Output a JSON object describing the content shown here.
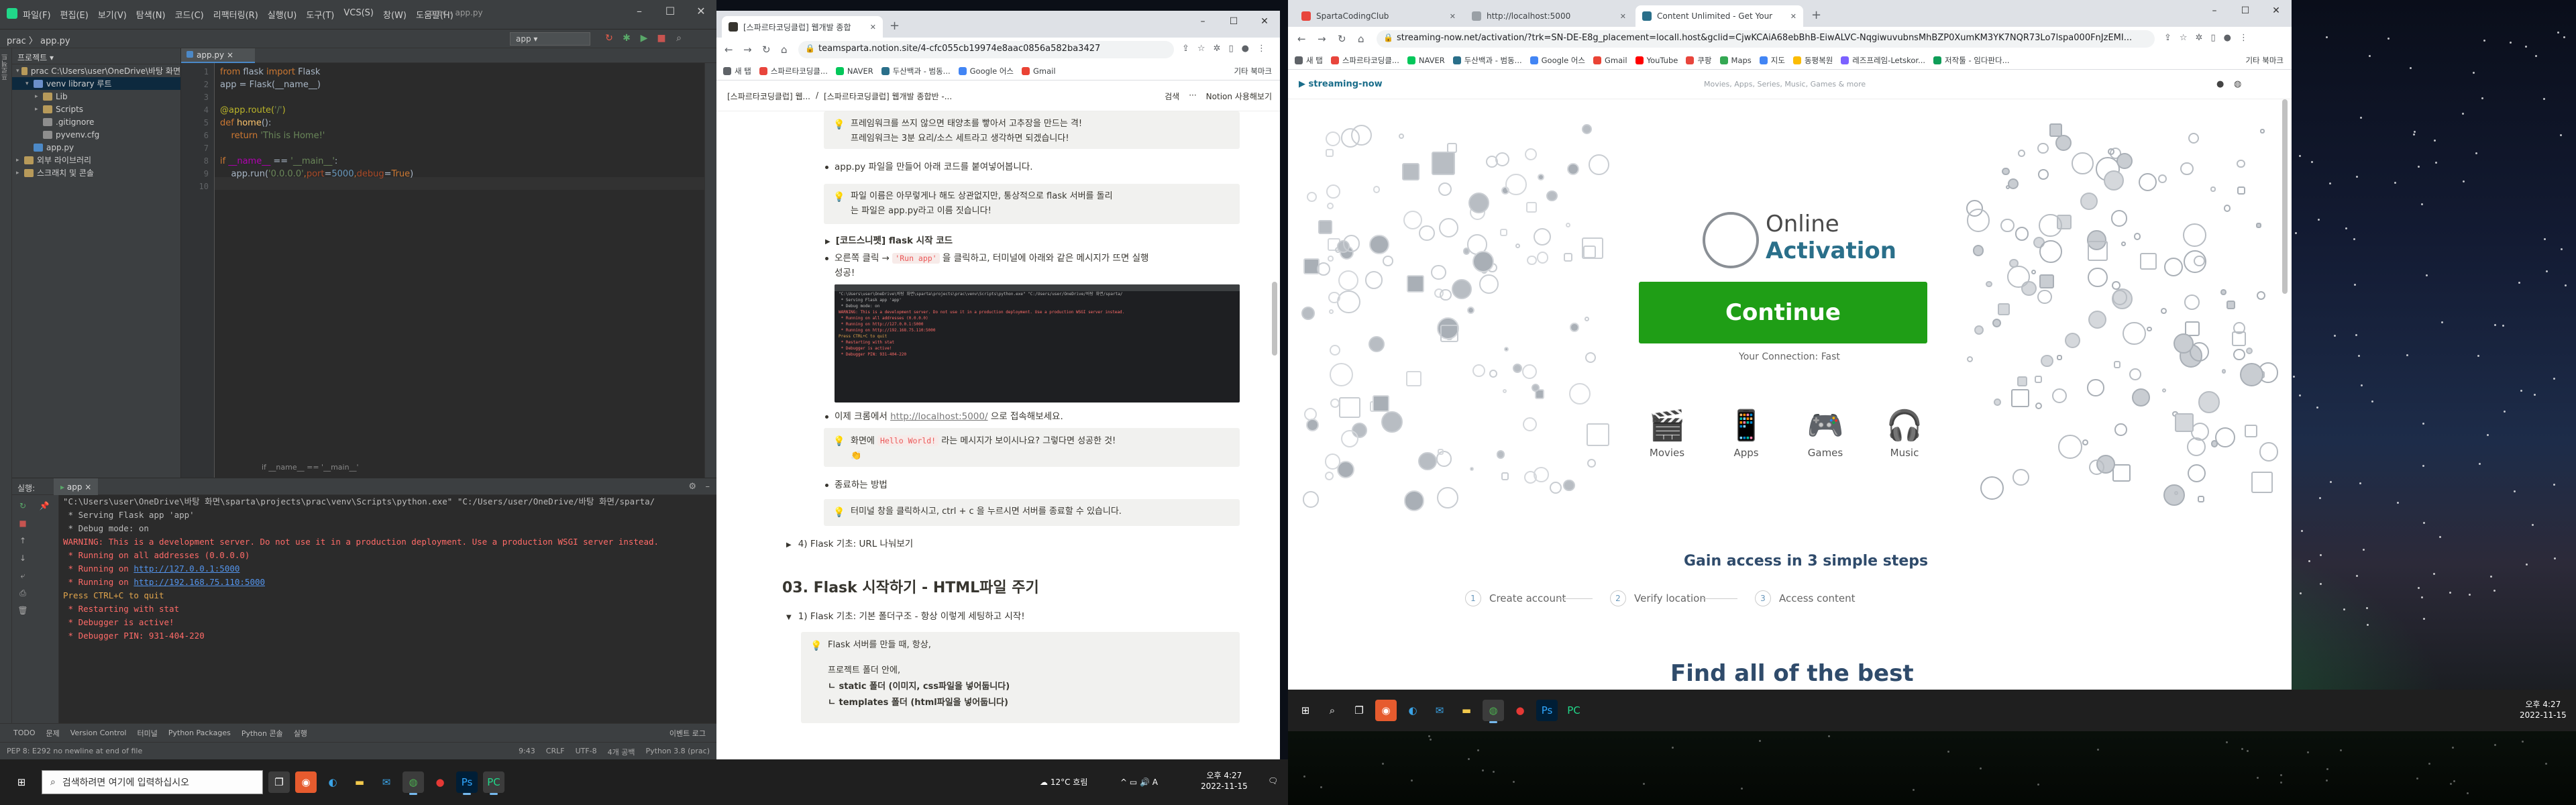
{
  "ide": {
    "menu": [
      "파일(F)",
      "편집(E)",
      "보기(V)",
      "탐색(N)",
      "코드(C)",
      "리팩터링(R)",
      "실행(U)",
      "도구(T)",
      "VCS(S)",
      "창(W)",
      "도움말(H)"
    ],
    "title": "prac - app.py",
    "breadcrumb": "prac 〉 app.py",
    "run_config": "app",
    "project_panel_title": "프로젝트",
    "tree": [
      {
        "label": "prac C:\\Users\\user\\OneDrive\\바탕 화면",
        "kind": "folder",
        "depth": 0,
        "open": true
      },
      {
        "label": "venv library 루트",
        "kind": "folder-blue",
        "depth": 1,
        "open": true,
        "selected": true
      },
      {
        "label": "Lib",
        "kind": "folder",
        "depth": 2,
        "open": false
      },
      {
        "label": "Scripts",
        "kind": "folder",
        "depth": 2,
        "open": false
      },
      {
        "label": ".gitignore",
        "kind": "cfg",
        "depth": 2
      },
      {
        "label": "pyvenv.cfg",
        "kind": "cfg",
        "depth": 2
      },
      {
        "label": "app.py",
        "kind": "py",
        "depth": 1
      },
      {
        "label": "외부 라이브러리",
        "kind": "folder",
        "depth": 0,
        "open": false
      },
      {
        "label": "스크래치 및 콘솔",
        "kind": "folder",
        "depth": 0,
        "open": false
      }
    ],
    "editor_tab": "app.py",
    "line_numbers": [
      "1",
      "2",
      "3",
      "4",
      "5",
      "6",
      "7",
      "8",
      "9",
      "10"
    ],
    "code": {
      "l1_a": "from",
      "l1_b": " flask ",
      "l1_c": "import",
      "l1_d": " Flask",
      "l2": "app = Flask(__name__)",
      "l4_a": "@app.route(",
      "l4_b": "'/'",
      "l4_c": ")",
      "l5_a": "def",
      "l5_b": " home",
      "l5_c": "():",
      "l6_a": "    return",
      "l6_b": " 'This is Home!'",
      "l8_a": "if",
      "l8_b": " __name__",
      "l8_c": " == ",
      "l8_d": "'__main__'",
      "l8_e": ":",
      "l9_a": "    app.run(",
      "l9_b": "'0.0.0.0'",
      "l9_c": ",",
      "l9_d": "port",
      "l9_e": "=",
      "l9_f": "5000",
      "l9_g": ",",
      "l9_h": "debug",
      "l9_i": "=",
      "l9_j": "True",
      "l9_k": ")"
    },
    "editor_footer": "if __name__ == '__main__'",
    "run_label": "실행:",
    "run_tab": "app",
    "console": [
      {
        "t": "\"C:\\Users\\user\\OneDrive\\바탕 화면\\sparta\\projects\\prac\\venv\\Scripts\\python.exe\" \"C:/Users/user/OneDrive/바탕 화면/sparta/",
        "c": "n"
      },
      {
        "t": " * Serving Flask app 'app'",
        "c": "n"
      },
      {
        "t": " * Debug mode: on",
        "c": "n"
      },
      {
        "t": "WARNING: This is a development server. Do not use it in a production deployment. Use a production WSGI server instead.",
        "c": "r"
      },
      {
        "t": " * Running on all addresses (0.0.0.0)",
        "c": "r"
      },
      {
        "t": " * Running on ",
        "c": "r",
        "link": "http://127.0.0.1:5000"
      },
      {
        "t": " * Running on ",
        "c": "r",
        "link": "http://192.168.75.110:5000"
      },
      {
        "t": "Press CTRL+C to quit",
        "c": "o"
      },
      {
        "t": " * Restarting with stat",
        "c": "r"
      },
      {
        "t": " * Debugger is active!",
        "c": "r"
      },
      {
        "t": " * Debugger PIN: 931-404-220",
        "c": "r"
      }
    ],
    "tool_tabs": [
      "TODO",
      "문제",
      "Version Control",
      "터미널",
      "Python Packages",
      "Python 콘솔",
      "실행"
    ],
    "event_log": "이벤트 로그",
    "status_left": "PEP 8: E292 no newline at end of file",
    "status_right": [
      "9:43",
      "CRLF",
      "UTF-8",
      "4개 공백",
      "Python 3.8 (prac)"
    ]
  },
  "notion_window": {
    "tabs": [
      {
        "label": "[스파르타코딩클럽] 웹개발 종합",
        "active": true,
        "favicon": "#e8e8e8"
      }
    ],
    "url": "teamsparta.notion.site/4-cfc055cb19974e8aac0856a582ba3427",
    "bookmarks": [
      "새 탭",
      "스파르타코딩클...",
      "NAVER",
      "두산백과 - 범동...",
      "Google 어스",
      "Gmail"
    ],
    "bookmarks_more": "기타 북마크",
    "crumb": [
      "[스파르타코딩클럽] 웹...",
      "[스파르타코딩클럽] 웹개발 종합반 -..."
    ],
    "actions": [
      "검색",
      "···"
    ],
    "notion_cta": "Notion 사용해보기",
    "callout1": [
      "프레임워크를 쓰지 않으면 태양초를 빻아서 고추장을 만드는 격!",
      "프레임워크는 3분 요리/소스 세트라고 생각하면 되겠습니다!"
    ],
    "bullet1": "app.py 파일을 만들어 아래 코드를 붙여넣어봅니다.",
    "callout2": [
      "파일 이름은 아무렇게나 해도 상관없지만, 통상적으로 flask 서버를 돌리",
      "는 파일은 app.py라고 이름 짓습니다!"
    ],
    "toggle1": "[코드스니펫] flask 시작 코드",
    "bullet2_a": "오른쪽 클릭 → ",
    "bullet2_code": "'Run app'",
    "bullet2_b": " 을 클릭하고, 터미널에 아래와 같은 메시지가 뜨면 실행",
    "bullet2_c": "성공!",
    "bullet3_a": "이제 크롬에서 ",
    "bullet3_link": "http://localhost:5000/",
    "bullet3_b": " 으로 접속해보세요.",
    "callout3_a": "화면에 ",
    "callout3_code": "Hello World!",
    "callout3_b": " 라는 메시지가 보이시나요? 그렇다면 성공한 것!",
    "bullet4": "종료하는 방법",
    "callout4": "터미널 창을 클릭하시고, ctrl + c 을 누르시면 서버를 종료할 수 있습니다.",
    "toggle2": "4) Flask 기초: URL 나눠보기",
    "heading": "03. Flask 시작하기 - HTML파일 주기",
    "toggle3": "1) Flask 기초: 기본 폴더구조 - 항상 이렇게 세팅하고 시작!",
    "callout5": [
      "Flask 서버를 만들 때, 항상,",
      "프로젝트 폴더 안에,",
      "ㄴ static 폴더 (이미지, css파일을 넣어둡니다)",
      "ㄴ templates 폴더 (html파일을 넣어둡니다)"
    ]
  },
  "stream_window": {
    "tabs": [
      {
        "label": "SpartaCodingClub",
        "favicon": "#e8453c"
      },
      {
        "label": "http://localhost:5000",
        "favicon": "#9aa0a6"
      },
      {
        "label": "Content Unlimited - Get Your",
        "favicon": "#2a6f8a",
        "active": true
      }
    ],
    "url": "streaming-now.net/activation/?trk=SN-DE-E8g_placement=locall.host&gclid=CjwKCAiA68ebBhB-EiwALVC-NqgiwuvubnsMhBZP0XumKM3YK7NQR73Lo7lspa000FnJzEMI...",
    "bookmarks": [
      "새 탭",
      "스파르타코딩클...",
      "NAVER",
      "두산백과 - 범동...",
      "Google 어스",
      "Gmail",
      "YouTube",
      "쿠팡",
      "Maps",
      "지도",
      "동평복원",
      "레즈프레임-Letskor...",
      "저작툴 - 임다판다..."
    ],
    "bookmarks_more": "기타 북마크",
    "logo": "streaming-now",
    "nav": "Movies, Apps, Series, Music, Games & more",
    "title1": "Online",
    "title2": "Activation",
    "continue": "Continue",
    "connection": "Your Connection: Fast",
    "categories": [
      {
        "label": "Movies",
        "icon": "clapperboard-icon",
        "glyph": "🎬"
      },
      {
        "label": "Apps",
        "icon": "phone-icon",
        "glyph": "📱"
      },
      {
        "label": "Games",
        "icon": "gamepad-icon",
        "glyph": "🎮"
      },
      {
        "label": "Music",
        "icon": "headphones-icon",
        "glyph": "🎧"
      }
    ],
    "gain": "Gain access in 3 simple steps",
    "steps": [
      {
        "num": "1",
        "label": "Create account"
      },
      {
        "num": "2",
        "label": "Verify location"
      },
      {
        "num": "3",
        "label": "Access content"
      }
    ],
    "findall": "Find all of the best"
  },
  "taskbar_left": {
    "search_placeholder": "검색하려면 여기에 입력하십시오",
    "weather": "12°C 흐림",
    "time": "오후 4:27",
    "date": "2022-11-15"
  },
  "taskbar_right": {
    "time": "오후 4:27",
    "date": "2022-11-15"
  }
}
